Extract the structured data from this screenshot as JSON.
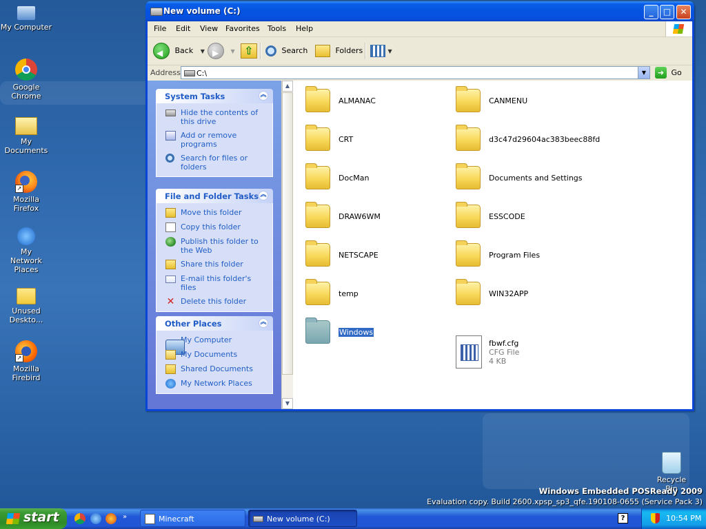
{
  "desktop": {
    "icons": [
      {
        "label": "My Computer",
        "icon": "my-computer-icon"
      },
      {
        "label": "Google Chrome",
        "icon": "chrome-icon"
      },
      {
        "label": "My Documents",
        "icon": "my-documents-icon"
      },
      {
        "label": "Mozilla Firefox",
        "icon": "firefox-icon"
      },
      {
        "label": "My Network Places",
        "icon": "network-places-icon"
      },
      {
        "label": "Unused Deskto...",
        "icon": "folder-icon"
      },
      {
        "label": "Mozilla Firebird",
        "icon": "firebird-icon"
      }
    ],
    "recycle_bin": "Recycle Bin",
    "watermark_title": "Windows Embedded POSReady 2009",
    "watermark_build": "Evaluation copy. Build 2600.xpsp_sp3_qfe.190108-0655 (Service Pack 3)"
  },
  "window": {
    "title": "New volume (C:)",
    "menu": [
      "File",
      "Edit",
      "View",
      "Favorites",
      "Tools",
      "Help"
    ],
    "toolbar": {
      "back": "Back",
      "search": "Search",
      "folders": "Folders"
    },
    "address": {
      "label": "Address",
      "value": "C:\\",
      "go": "Go"
    },
    "task_pane": {
      "system_tasks": {
        "title": "System Tasks",
        "items": [
          "Hide the contents of this drive",
          "Add or remove programs",
          "Search for files or folders"
        ]
      },
      "file_folder_tasks": {
        "title": "File and Folder Tasks",
        "items": [
          "Move this folder",
          "Copy this folder",
          "Publish this folder to the Web",
          "Share this folder",
          "E-mail this folder's files",
          "Delete this folder"
        ]
      },
      "other_places": {
        "title": "Other Places",
        "items": [
          "My Computer",
          "My Documents",
          "Shared Documents",
          "My Network Places"
        ]
      }
    },
    "files": [
      {
        "name": "ALMANAC",
        "type": "folder"
      },
      {
        "name": "CANMENU",
        "type": "folder"
      },
      {
        "name": "CRT",
        "type": "folder"
      },
      {
        "name": "d3c47d29604ac383beec88fd",
        "type": "folder"
      },
      {
        "name": "DocMan",
        "type": "folder"
      },
      {
        "name": "Documents and Settings",
        "type": "folder"
      },
      {
        "name": "DRAW6WM",
        "type": "folder"
      },
      {
        "name": "ESSCODE",
        "type": "folder"
      },
      {
        "name": "NETSCAPE",
        "type": "folder"
      },
      {
        "name": "Program Files",
        "type": "folder"
      },
      {
        "name": "temp",
        "type": "folder"
      },
      {
        "name": "WIN32APP",
        "type": "folder"
      },
      {
        "name": "Windows",
        "type": "folder",
        "selected": true
      },
      {
        "name": "fbwf.cfg",
        "type": "file",
        "kind": "CFG File",
        "size": "4 KB"
      }
    ]
  },
  "taskbar": {
    "start": "start",
    "tasks": [
      "Minecraft",
      "New volume (C:)"
    ],
    "active_task": "New volume (C:)",
    "clock": "10:54 PM"
  }
}
